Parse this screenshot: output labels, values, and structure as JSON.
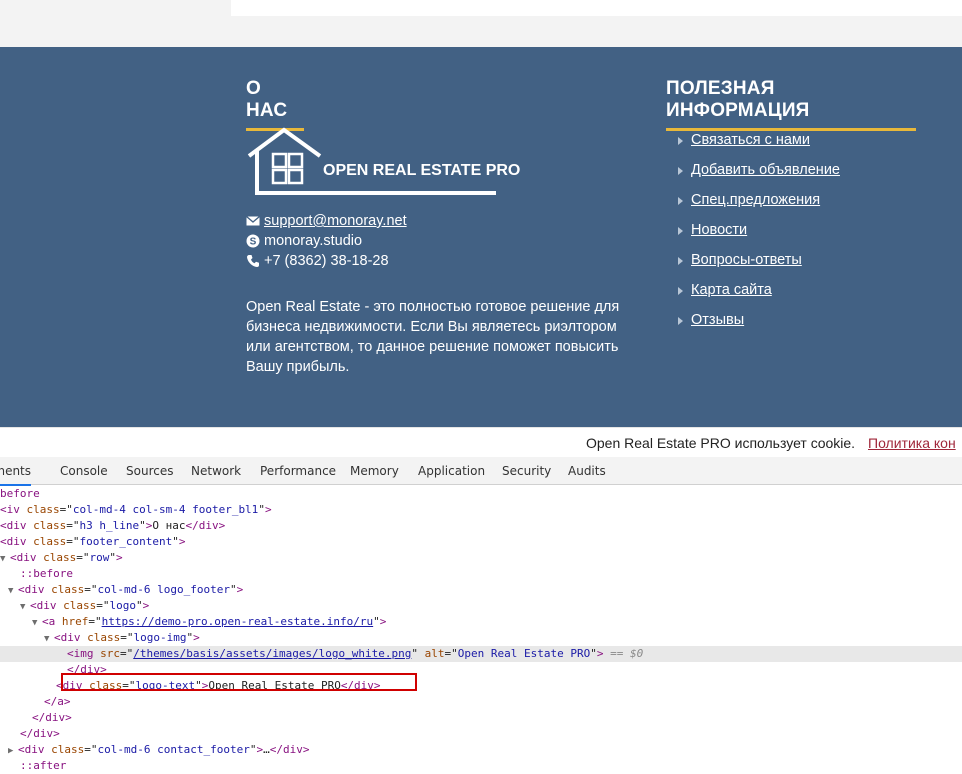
{
  "footer": {
    "about_title": "О НАС",
    "useful_title": "ПОЛЕЗНАЯ ИНФОРМАЦИЯ",
    "logo_text": "OPEN REAL ESTATE PRO",
    "email": "support@monoray.net",
    "skype": "monoray.studio",
    "phone": "+7 (8362) 38-18-28",
    "about_text": "Open Real Estate - это полностью готовое решение для бизнеса недвижимости. Если Вы являетесь риэлтором или агентством, то данное решение поможет повысить Вашу прибыль.",
    "links": [
      "Связаться с нами",
      "Добавить объявление",
      "Спец.предложения",
      "Новости",
      "Вопросы-ответы",
      "Карта сайта",
      "Отзывы"
    ],
    "accent_color": "#e8b83a",
    "background_color": "#426184"
  },
  "cookie": {
    "text": "Open Real Estate PRO использует cookie.",
    "link": "Политика кон"
  },
  "devtools": {
    "tabs": [
      "ements",
      "Console",
      "Sources",
      "Network",
      "Performance",
      "Memory",
      "Application",
      "Security",
      "Audits"
    ],
    "active_tab": "ements",
    "tree": {
      "l0": "before",
      "l1_tag": "iv",
      "l1_class": "col-md-4 col-sm-4 footer_bl1",
      "l2_tag": "div",
      "l2_class": "h3 h_line",
      "l2_text": "О нас",
      "l3_tag": "div",
      "l3_class": "footer_content",
      "l4_tag": "div",
      "l4_class": "row",
      "l5": "::before",
      "l6_tag": "div",
      "l6_class": "col-md-6 logo_footer",
      "l7_tag": "div",
      "l7_class": "logo",
      "l8_tag": "a",
      "l8_href": "https://demo-pro.open-real-estate.info/ru",
      "l9_tag": "div",
      "l9_class": "logo-img",
      "l10_tag": "img",
      "l10_src": "/themes/basis/assets/images/logo_white.png",
      "l10_alt": "Open Real Estate PRO",
      "l10_suffix": "== $0",
      "l11": "</div>",
      "l12_tag": "div",
      "l12_class": "logo-text",
      "l12_text": "Open Real Estate PRO",
      "l13": "</a>",
      "l14": "</div>",
      "l15": "</div>",
      "l16_tag": "div",
      "l16_class": "col-md-6 contact_footer",
      "l16_ellipsis": "…",
      "l17": "::after"
    }
  }
}
